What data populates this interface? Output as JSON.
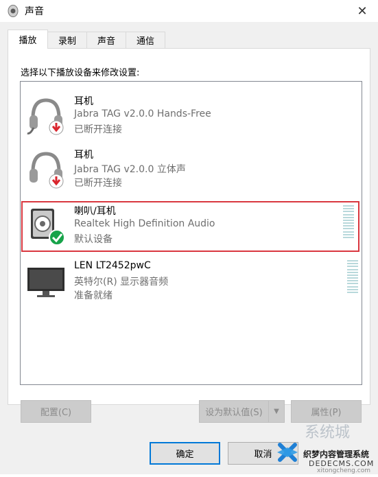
{
  "window": {
    "title": "声音",
    "close_glyph": "✕"
  },
  "tabs": [
    {
      "label": "播放",
      "active": true
    },
    {
      "label": "录制",
      "active": false
    },
    {
      "label": "声音",
      "active": false
    },
    {
      "label": "通信",
      "active": false
    }
  ],
  "instruction": "选择以下播放设备来修改设置:",
  "devices": [
    {
      "name": "耳机",
      "driver": "Jabra TAG v2.0.0 Hands-Free",
      "status": "已断开连接",
      "icon": "headset-icon",
      "badge": "disconnected-badge",
      "selected": false
    },
    {
      "name": "耳机",
      "driver": "Jabra TAG v2.0.0 立体声",
      "status": "已断开连接",
      "icon": "headphones-icon",
      "badge": "disconnected-badge",
      "selected": false
    },
    {
      "name": "喇叭/耳机",
      "driver": "Realtek High Definition Audio",
      "status": "默认设备",
      "icon": "speaker-icon",
      "badge": "default-check-badge",
      "selected": true
    },
    {
      "name": "LEN LT2452pwC",
      "driver": "英特尔(R) 显示器音频",
      "status": "准备就绪",
      "icon": "monitor-icon",
      "badge": "",
      "selected": false
    }
  ],
  "buttons": {
    "configure": "配置(C)",
    "set_default": "设为默认值(S)",
    "set_default_arrow": "▼",
    "properties": "属性(P)",
    "ok": "确定",
    "cancel": "取消"
  },
  "watermark": {
    "brand": "系统城",
    "site_cn": "织梦内容管理系统",
    "site_url": "DEDECMS.COM",
    "small_url": "xitongcheng.com"
  },
  "colors": {
    "selection_outline": "#d9363e",
    "default_button_border": "#0078d7",
    "check_green": "#17a34a",
    "disconnect_red": "#d9262e",
    "vu_meter": "#b8d8db"
  }
}
